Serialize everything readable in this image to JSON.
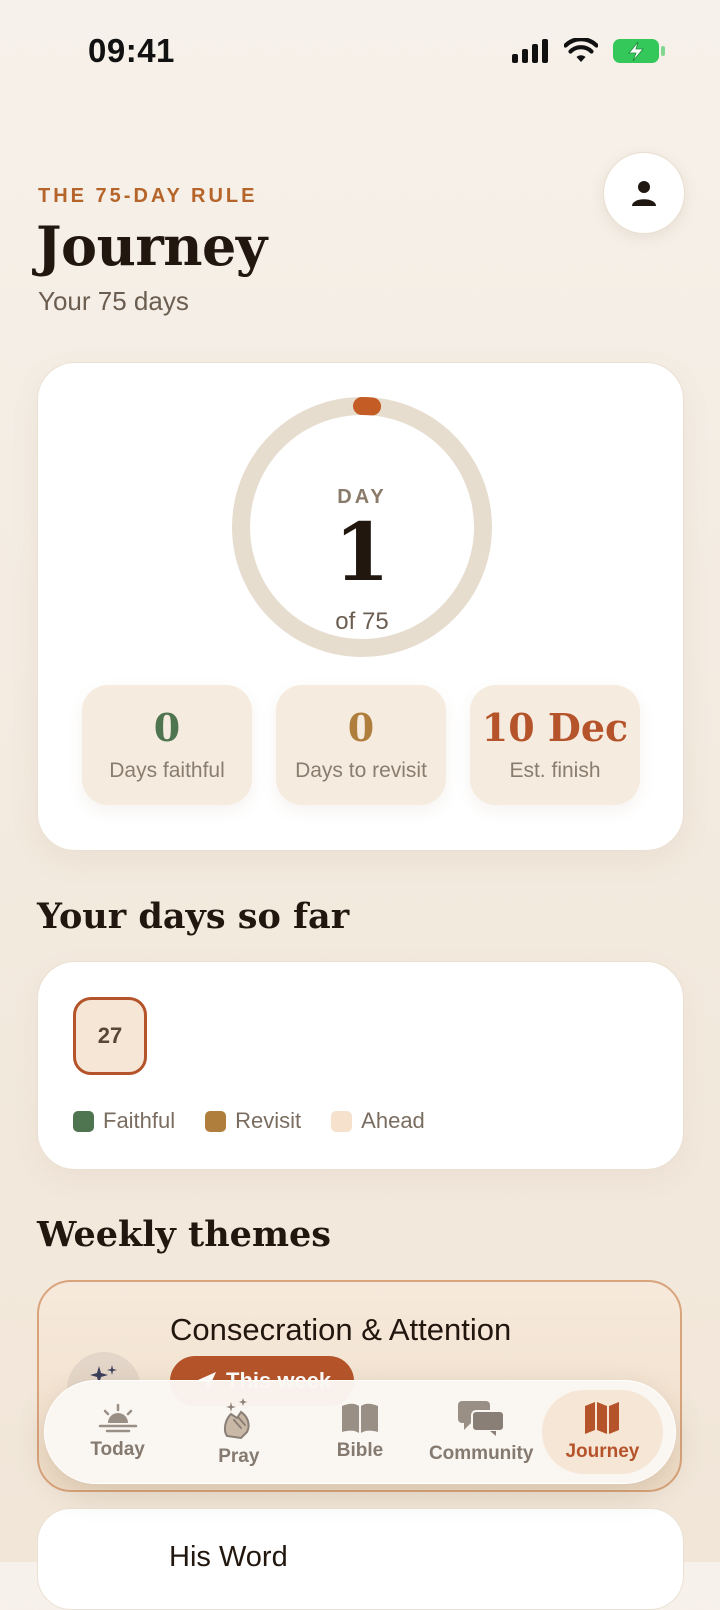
{
  "status_bar": {
    "time": "09:41"
  },
  "header": {
    "eyebrow": "THE 75-DAY RULE",
    "title": "Journey",
    "subtitle": "Your 75 days"
  },
  "progress": {
    "day_label": "DAY",
    "day_value": "1",
    "of_label": "of 75",
    "progress_fraction": 0.0133,
    "stats": [
      {
        "value": "0",
        "label": "Days faithful"
      },
      {
        "value": "0",
        "label": "Days to revisit"
      },
      {
        "value": "10 Dec",
        "label": "Est. finish"
      }
    ]
  },
  "days_section": {
    "title": "Your days so far",
    "cells": [
      "27"
    ],
    "legend": [
      "Faithful",
      "Revisit",
      "Ahead"
    ]
  },
  "themes_section": {
    "title": "Weekly themes",
    "current": {
      "title": "Consecration & Attention",
      "badge": "This week"
    },
    "next": {
      "title": "His Word"
    }
  },
  "tabbar": {
    "items": [
      {
        "label": "Today",
        "icon": "sunrise-icon"
      },
      {
        "label": "Pray",
        "icon": "praying-hands-icon"
      },
      {
        "label": "Bible",
        "icon": "book-icon"
      },
      {
        "label": "Community",
        "icon": "chat-bubbles-icon"
      },
      {
        "label": "Journey",
        "icon": "map-icon"
      }
    ],
    "active": "Journey"
  },
  "colors": {
    "accent": "#b5542a",
    "faithful": "#4f7450",
    "revisit": "#b07e3c",
    "ahead": "#f5e1cc"
  }
}
